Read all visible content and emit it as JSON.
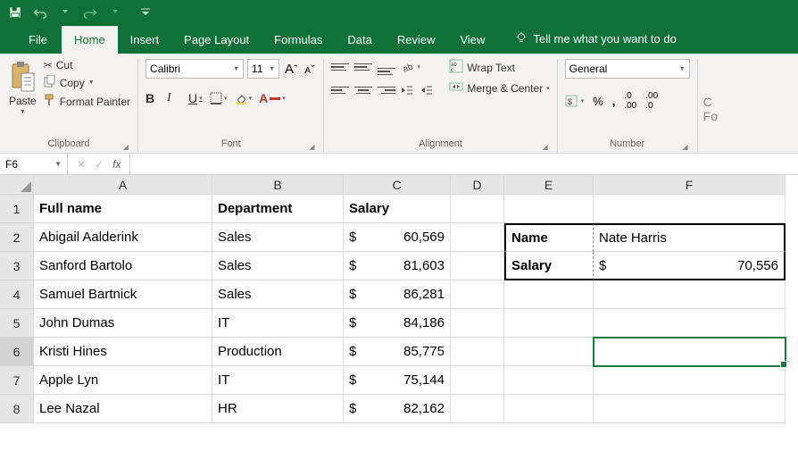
{
  "qat": {
    "save": "save-icon",
    "undo": "undo-icon",
    "redo": "redo-icon"
  },
  "tabs": [
    "File",
    "Home",
    "Insert",
    "Page Layout",
    "Formulas",
    "Data",
    "Review",
    "View"
  ],
  "active_tab": "Home",
  "tell_me": "Tell me what you want to do",
  "ribbon": {
    "clipboard": {
      "label": "Clipboard",
      "paste": "Paste",
      "cut": "Cut",
      "copy": "Copy",
      "format_painter": "Format Painter"
    },
    "font": {
      "label": "Font",
      "name": "Calibri",
      "size": "11"
    },
    "alignment": {
      "label": "Alignment",
      "wrap": "Wrap Text",
      "merge": "Merge & Center"
    },
    "number": {
      "label": "Number",
      "format": "General"
    },
    "cells_hint": "C",
    "cells_hint2": "Fo"
  },
  "name_box": "F6",
  "formula": "",
  "columns": [
    "A",
    "B",
    "C",
    "D",
    "E",
    "F"
  ],
  "row_nums": [
    "1",
    "2",
    "3",
    "4",
    "5",
    "6",
    "7",
    "8"
  ],
  "headers": {
    "fullname": "Full name",
    "department": "Department",
    "salary": "Salary"
  },
  "rows": [
    {
      "name": "Abigail Aalderink",
      "dept": "Sales",
      "sal": "60,569"
    },
    {
      "name": "Sanford Bartolo",
      "dept": "Sales",
      "sal": "81,603"
    },
    {
      "name": "Samuel Bartnick",
      "dept": "Sales",
      "sal": "86,281"
    },
    {
      "name": "John Dumas",
      "dept": "IT",
      "sal": "84,186"
    },
    {
      "name": "Kristi Hines",
      "dept": "Production",
      "sal": "85,775"
    },
    {
      "name": "Apple Lyn",
      "dept": "IT",
      "sal": "75,144"
    },
    {
      "name": "Lee Nazal",
      "dept": "HR",
      "sal": "82,162"
    }
  ],
  "lookup": {
    "name_label": "Name",
    "name_val": "Nate Harris",
    "sal_label": "Salary",
    "sal_val": "70,556"
  },
  "chart_data": {
    "type": "table",
    "columns": [
      "Full name",
      "Department",
      "Salary"
    ],
    "rows": [
      [
        "Abigail Aalderink",
        "Sales",
        60569
      ],
      [
        "Sanford Bartolo",
        "Sales",
        81603
      ],
      [
        "Samuel Bartnick",
        "Sales",
        86281
      ],
      [
        "John Dumas",
        "IT",
        84186
      ],
      [
        "Kristi Hines",
        "Production",
        85775
      ],
      [
        "Apple Lyn",
        "IT",
        75144
      ],
      [
        "Lee Nazal",
        "HR",
        82162
      ]
    ],
    "lookup": {
      "Name": "Nate Harris",
      "Salary": 70556
    }
  }
}
